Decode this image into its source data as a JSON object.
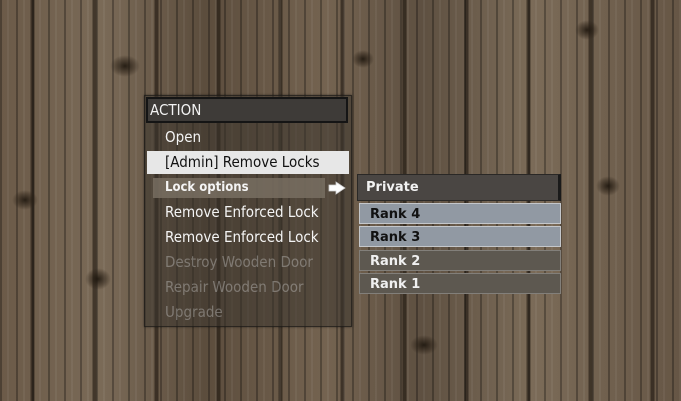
{
  "menu": {
    "title": "ACTION",
    "items": [
      {
        "label": "Open",
        "state": "normal"
      },
      {
        "label": "[Admin] Remove Locks",
        "state": "selected"
      },
      {
        "label": "Lock options",
        "state": "submenu"
      },
      {
        "label": "Remove Enforced Lock",
        "state": "normal"
      },
      {
        "label": "Remove Enforced Lock",
        "state": "normal"
      },
      {
        "label": "Destroy Wooden Door",
        "state": "disabled"
      },
      {
        "label": "Repair Wooden Door",
        "state": "disabled"
      },
      {
        "label": "Upgrade",
        "state": "disabled"
      }
    ]
  },
  "submenu": {
    "title": "Private",
    "items": [
      {
        "label": "Rank 4",
        "state": "highlighted"
      },
      {
        "label": "Rank 3",
        "state": "highlighted"
      },
      {
        "label": "Rank 2",
        "state": "normal"
      },
      {
        "label": "Rank 1",
        "state": "normal"
      }
    ]
  },
  "icons": {
    "submenu_arrow": "pointing-hand-arrow-icon"
  },
  "colors": {
    "selected_bg": "#e7e7e7",
    "highlight_bg": "#9199a3",
    "header_bg": "#3e3b38",
    "disabled_text": "#8a8580"
  }
}
